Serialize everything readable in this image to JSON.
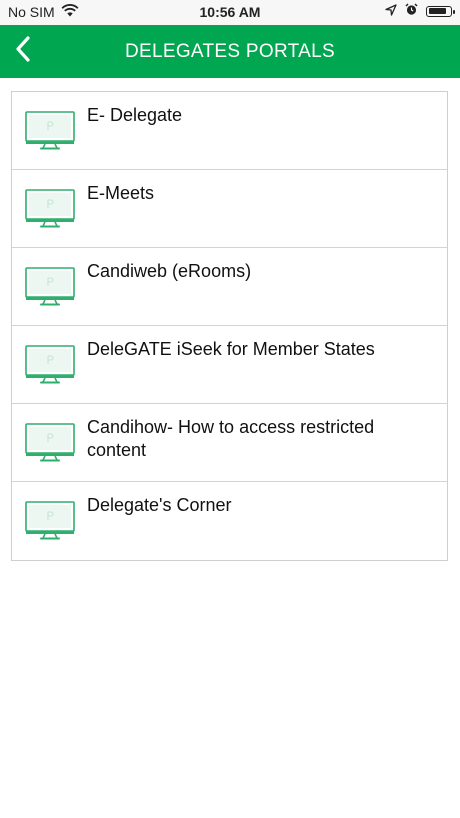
{
  "status_bar": {
    "carrier": "No SIM",
    "time": "10:56 AM",
    "battery_level": 0.85
  },
  "header": {
    "title": "DELEGATES PORTALS",
    "back_icon": "chevron-left-icon"
  },
  "colors": {
    "brand": "#00a650",
    "icon_accent": "#2fae6d"
  },
  "items": [
    {
      "label": "E- Delegate",
      "icon": "monitor-icon"
    },
    {
      "label": "E-Meets",
      "icon": "monitor-icon"
    },
    {
      "label": "Candiweb (eRooms)",
      "icon": "monitor-icon"
    },
    {
      "label": "DeleGATE iSeek for Member States",
      "icon": "monitor-icon"
    },
    {
      "label": "Candihow- How to access restricted content",
      "icon": "monitor-icon"
    },
    {
      "label": "Delegate's Corner",
      "icon": "monitor-icon"
    }
  ]
}
